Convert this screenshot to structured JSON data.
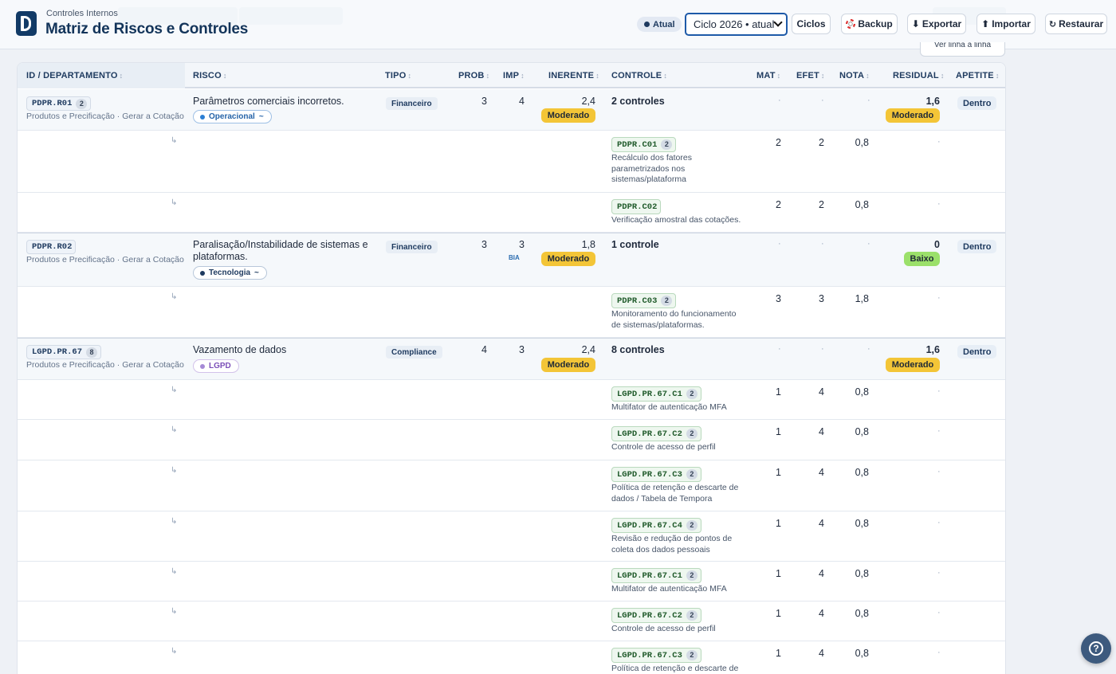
{
  "header": {
    "subtitle": "Controles Internos",
    "title": "Matriz de Riscos e Controles",
    "status_badge": "Atual",
    "cycle_select": "Ciclo 2026 • atual",
    "buttons": {
      "ciclos": "Ciclos",
      "backup": "Backup",
      "exportar": "Exportar",
      "importar": "Importar",
      "restaurar": "Restaurar"
    },
    "ver_linha": "Ver linha a linha"
  },
  "icons": {
    "backup": "lifebuoy-icon",
    "exportar": "download-arrow-icon",
    "importar": "upload-arrow-icon",
    "restaurar": "restore-icon",
    "help": "help-icon"
  },
  "colors": {
    "brand": "#123a66",
    "moderado": "#f3c537",
    "baixo": "#9be06a",
    "select_border": "#1e5aa8"
  },
  "table": {
    "columns": {
      "id": "ID / DEPARTAMENTO",
      "risco": "RISCO",
      "tipo": "TIPO",
      "prob": "PROB",
      "imp": "IMP",
      "inerente": "INERENTE",
      "controle": "CONTROLE",
      "mat": "MAT",
      "efet": "EFET",
      "nota": "NOTA",
      "residual": "RESIDUAL",
      "apetite": "APETITE"
    },
    "sort_glyph": "↕",
    "risks": [
      {
        "id": "PDPR.R01",
        "count": "2",
        "dept": "Produtos e Precificação · Gerar a Cotação",
        "risco": "Parâmetros comerciais incorretos.",
        "categoria": "Operacional",
        "categoria_suffix": "~",
        "tipo": "Financeiro",
        "prob": "3",
        "imp": "4",
        "bia": "",
        "inerente": "2,4",
        "inerente_nivel": "Moderado",
        "controles": "2 controles",
        "mat": "·",
        "efet": "·",
        "nota": "·",
        "residual": "1,6",
        "residual_nivel": "Moderado",
        "apetite": "Dentro"
      },
      {
        "id": "PDPR.R02",
        "count": "",
        "dept": "Produtos e Precificação · Gerar a Cotação",
        "risco": "Paralisação/Instabilidade de sistemas e plataformas.",
        "categoria": "Tecnologia",
        "categoria_suffix": "~",
        "tipo": "Financeiro",
        "prob": "3",
        "imp": "3",
        "bia": "BIA",
        "inerente": "1,8",
        "inerente_nivel": "Moderado",
        "controles": "1 controle",
        "mat": "·",
        "efet": "·",
        "nota": "·",
        "residual": "0",
        "residual_nivel": "Baixo",
        "apetite": "Dentro"
      },
      {
        "id": "LGPD.PR.67",
        "count": "8",
        "dept": "Produtos e Precificação · Gerar a Cotação",
        "risco": "Vazamento de dados",
        "categoria": "LGPD",
        "categoria_suffix": "",
        "tipo": "Compliance",
        "prob": "4",
        "imp": "3",
        "bia": "",
        "inerente": "2,4",
        "inerente_nivel": "Moderado",
        "controles": "8 controles",
        "mat": "·",
        "efet": "·",
        "nota": "·",
        "residual": "1,6",
        "residual_nivel": "Moderado",
        "apetite": "Dentro"
      }
    ],
    "controls": [
      {
        "code": "PDPR.C01",
        "count": "2",
        "desc": "Recálculo dos fatores parametrizados nos sistemas/plataforma",
        "mat": "2",
        "efet": "2",
        "nota": "0,8",
        "residual": "·"
      },
      {
        "code": "PDPR.C02",
        "count": "",
        "desc": "Verificação amostral das cotações.",
        "mat": "2",
        "efet": "2",
        "nota": "0,8",
        "residual": "·"
      },
      {
        "code": "PDPR.C03",
        "count": "2",
        "desc": "Monitoramento do funcionamento de sistemas/plataformas.",
        "mat": "3",
        "efet": "3",
        "nota": "1,8",
        "residual": "·"
      },
      {
        "code": "LGPD.PR.67.C1",
        "count": "2",
        "desc": "Multifator de autenticação MFA",
        "mat": "1",
        "efet": "4",
        "nota": "0,8",
        "residual": "·"
      },
      {
        "code": "LGPD.PR.67.C2",
        "count": "2",
        "desc": "Controle de acesso de perfil",
        "mat": "1",
        "efet": "4",
        "nota": "0,8",
        "residual": "·"
      },
      {
        "code": "LGPD.PR.67.C3",
        "count": "2",
        "desc": "Política de retenção e descarte de dados / Tabela de Tempora",
        "mat": "1",
        "efet": "4",
        "nota": "0,8",
        "residual": "·"
      },
      {
        "code": "LGPD.PR.67.C4",
        "count": "2",
        "desc": "Revisão e redução de pontos de coleta dos dados pessoais",
        "mat": "1",
        "efet": "4",
        "nota": "0,8",
        "residual": "·"
      },
      {
        "code": "LGPD.PR.67.C1",
        "count": "2",
        "desc": "Multifator de autenticação MFA",
        "mat": "1",
        "efet": "4",
        "nota": "0,8",
        "residual": "·"
      },
      {
        "code": "LGPD.PR.67.C2",
        "count": "2",
        "desc": "Controle de acesso de perfil",
        "mat": "1",
        "efet": "4",
        "nota": "0,8",
        "residual": "·"
      },
      {
        "code": "LGPD.PR.67.C3",
        "count": "2",
        "desc": "Política de retenção e descarte de",
        "mat": "1",
        "efet": "4",
        "nota": "0,8",
        "residual": "·"
      }
    ],
    "sub_arrow": "↳"
  }
}
